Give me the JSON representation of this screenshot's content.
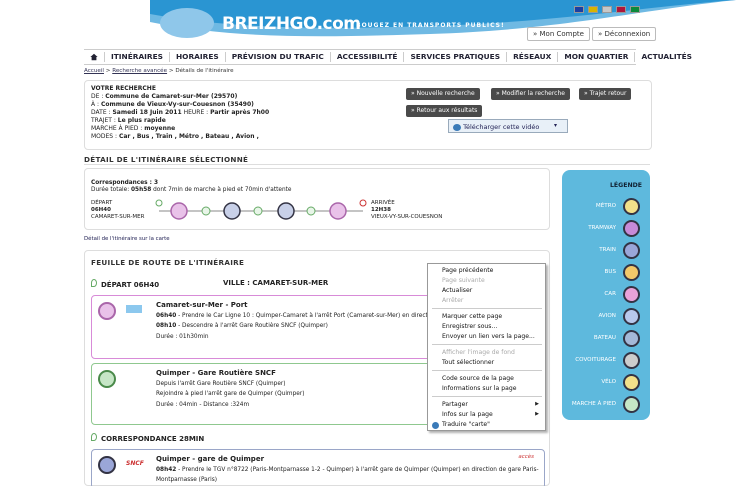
{
  "header": {
    "logo": "BREIZHGO.com",
    "tagline": "BOUGEZ EN TRANSPORTS PUBLICS!",
    "account_btn": "» Mon Compte",
    "logout_btn": "» Déconnexion",
    "flags": [
      "#1a3fa3",
      "#d8b400",
      "#c8c8c8",
      "#b0153a",
      "#0a8a3a"
    ]
  },
  "nav": {
    "items": [
      "ITINÉRAIRES",
      "HORAIRES",
      "PRÉVISION DU TRAFIC",
      "ACCESSIBILITÉ",
      "SERVICES PRATIQUES",
      "RÉSEAUX",
      "MON QUARTIER",
      "ACTUALITÉS"
    ]
  },
  "breadcrumb": {
    "home": "Accueil",
    "advanced": "Recherche avancée",
    "current": "Détails de l'itinéraire"
  },
  "search": {
    "title": "VOTRE RECHERCHE",
    "from_label": "DE :",
    "from": "Commune de Camaret-sur-Mer (29570)",
    "to_label": "À :",
    "to": "Commune de Vieux-Vy-sur-Couesnon (35490)",
    "date_label": "DATE :",
    "date": "Samedi 18 Juin 2011",
    "hour_label": "HEURE :",
    "hour": "Partir après 7h00",
    "trip_label": "TRAJET :",
    "trip": "Le plus rapide",
    "walk_label": "MARCHE À PIED :",
    "walk": "moyenne",
    "modes_label": "MODES :",
    "modes": "Car , Bus , Train , Métro , Bateau , Avion ,",
    "buttons": [
      "» Nouvelle recherche",
      "» Modifier la recherche",
      "» Trajet retour",
      "» Retour aux résultats"
    ],
    "video_btn": "Télécharger cette vidéo"
  },
  "detail": {
    "title": "DÉTAIL DE L'ITINÉRAIRE SÉLECTIONNÉ",
    "correspondances": "Correspondances : 3",
    "duration_label": "Durée totale:",
    "duration": "05h58",
    "duration_rest": "dont 7min de marche à pied et 70min d'attente",
    "depart_label": "DÉPART",
    "depart_time": "06H40",
    "depart_place": "CAMARET-SUR-MER",
    "arrival_label": "ARRIVÉE",
    "arrival_time": "12H38",
    "arrival_place": "VIEUX-VY-SUR-COUESNON",
    "map_link": "Détail de l'itinéraire sur la carte"
  },
  "roadmap": {
    "title": "FEUILLE DE ROUTE DE L'ITINÉRAIRE",
    "depart": "DÉPART 06H40",
    "ville": "VILLE : CAMARET-SUR-MER",
    "step1_title": "Camaret-sur-Mer - Port",
    "step1_l1_time": "06h40",
    "step1_l1": "- Prendre le Car Ligne 10   : Quimper-Camaret à l'arrêt Port (Camaret-sur-Mer) en directio",
    "step1_l2_time": "08h10",
    "step1_l2": "- Descendre à l'arrêt Gare Routière SNCF (Quimper)",
    "step1_l3": "Durée : 01h30min",
    "step2_title": "Quimper - Gare Routière SNCF",
    "step2_l1": "Depuis l'arrêt Gare Routière SNCF (Quimper)",
    "step2_l2": "Rejoindre à pied l'arrêt gare de Quimper (Quimper)",
    "step2_l3": "Durée : 04min - Distance :324m",
    "corr": "CORRESPONDANCE  28MIN",
    "step3_title": "Quimper - gare de Quimper",
    "step3_l1_time": "08h42",
    "step3_l1": "- Prendre le TGV  n°8722  (Paris-Montparnasse 1-2 - Quimper) à l'arrêt gare de Quimper (Quimper) en direction de gare Paris-",
    "step3_l2": "Montparnasse (Paris)",
    "acces": "accès",
    "snc": "SNCF"
  },
  "legend": {
    "title": "LÉGENDE",
    "items": [
      "MÉTRO",
      "TRAMWAY",
      "TRAIN",
      "BUS",
      "CAR",
      "AVION",
      "BATEAU",
      "COVOITURAGE",
      "VÉLO",
      "MARCHE À PIED"
    ]
  },
  "context_menu": {
    "items": [
      "Page précédente",
      "Page suivante",
      "Actualiser",
      "Arrêter",
      "Marquer cette page",
      "Enregistrer sous...",
      "Envoyer un lien vers la page...",
      "Afficher l'image de fond",
      "Tout sélectionner",
      "Code source de la page",
      "Informations sur la page",
      "Partager",
      "Infos sur la page",
      "Traduire \"carte\""
    ]
  }
}
